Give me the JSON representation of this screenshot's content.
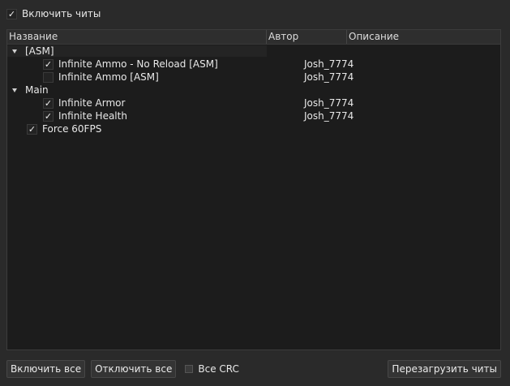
{
  "top": {
    "enable_cheats_label": "Включить читы",
    "enable_cheats_checked": true
  },
  "tree": {
    "columns": [
      "Название",
      "Автор",
      "Описание"
    ],
    "groups": [
      {
        "label": "[ASM]",
        "expanded": true,
        "items": [
          {
            "name": "Infinite Ammo - No Reload [ASM]",
            "author": "Josh_7774",
            "checked": true
          },
          {
            "name": "Infinite Ammo [ASM]",
            "author": "Josh_7774",
            "checked": false
          }
        ]
      },
      {
        "label": "Main",
        "expanded": true,
        "items": [
          {
            "name": "Infinite Armor",
            "author": "Josh_7774",
            "checked": true
          },
          {
            "name": "Infinite Health",
            "author": "Josh_7774",
            "checked": true
          }
        ]
      }
    ],
    "root_items": [
      {
        "name": "Force 60FPS",
        "checked": true
      }
    ]
  },
  "bottom": {
    "enable_all_label": "Включить все",
    "disable_all_label": "Отключить все",
    "all_crc_label": "Все CRC",
    "all_crc_checked": false,
    "reload_label": "Перезагрузить читы"
  }
}
